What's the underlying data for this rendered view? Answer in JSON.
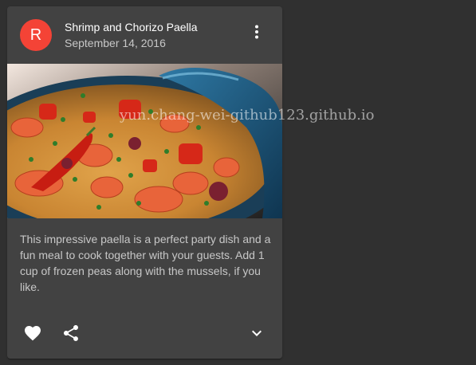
{
  "card": {
    "avatar_letter": "R",
    "title": "Shrimp and Chorizo Paella",
    "subheader": "September 14, 2016",
    "body": "This impressive paella is a perfect party dish and a fun meal to cook together with your guests. Add 1 cup of frozen peas along with the mussels, if you like.",
    "watermark": "yun.chang-wei-github123.github.io"
  },
  "icons": {
    "more": "more-vert-icon",
    "favorite": "favorite-icon",
    "share": "share-icon",
    "expand": "expand-more-icon"
  },
  "colors": {
    "background": "#303030",
    "card": "#424242",
    "avatar": "#f44336",
    "icon": "#ffffff"
  }
}
